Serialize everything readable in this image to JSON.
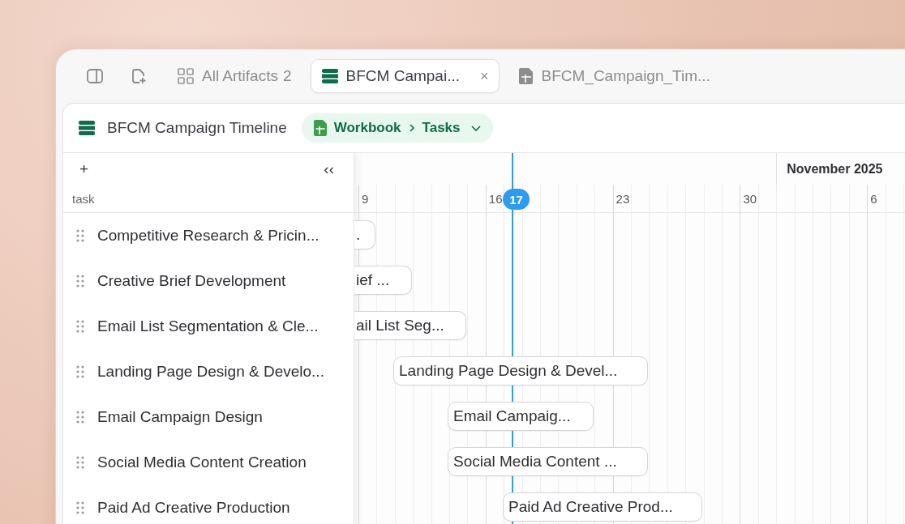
{
  "tabs": [
    {
      "kind": "artifacts",
      "label": "All Artifacts",
      "count": "2",
      "selected": false
    },
    {
      "kind": "table",
      "label": "BFCM Campai...",
      "close": "×",
      "selected": true
    },
    {
      "kind": "file",
      "label": "BFCM_Campaign_Tim...",
      "selected": false
    }
  ],
  "header": {
    "title": "BFCM Campaign Timeline",
    "breadcrumb": [
      "Workbook",
      "Tasks"
    ]
  },
  "gantt": {
    "add": "+",
    "collapse": "‹‹",
    "task_column": "task",
    "month": "November 2025",
    "days": [
      "9",
      "16",
      "23",
      "30",
      "6"
    ],
    "today": "17",
    "tasks": [
      {
        "name": "Competitive Research & Pricin...",
        "bar_label": "."
      },
      {
        "name": "Creative Brief Development",
        "bar_label": "ief ..."
      },
      {
        "name": "Email List Segmentation & Cle...",
        "bar_label": "ail List Seg..."
      },
      {
        "name": "Landing Page Design & Develo...",
        "bar_label": "Landing Page Design & Devel..."
      },
      {
        "name": "Email Campaign Design",
        "bar_label": "Email Campaig..."
      },
      {
        "name": "Social Media Content Creation",
        "bar_label": "Social Media Content ..."
      },
      {
        "name": "Paid Ad Creative Production",
        "bar_label": "Paid Ad Creative Prod..."
      }
    ]
  }
}
